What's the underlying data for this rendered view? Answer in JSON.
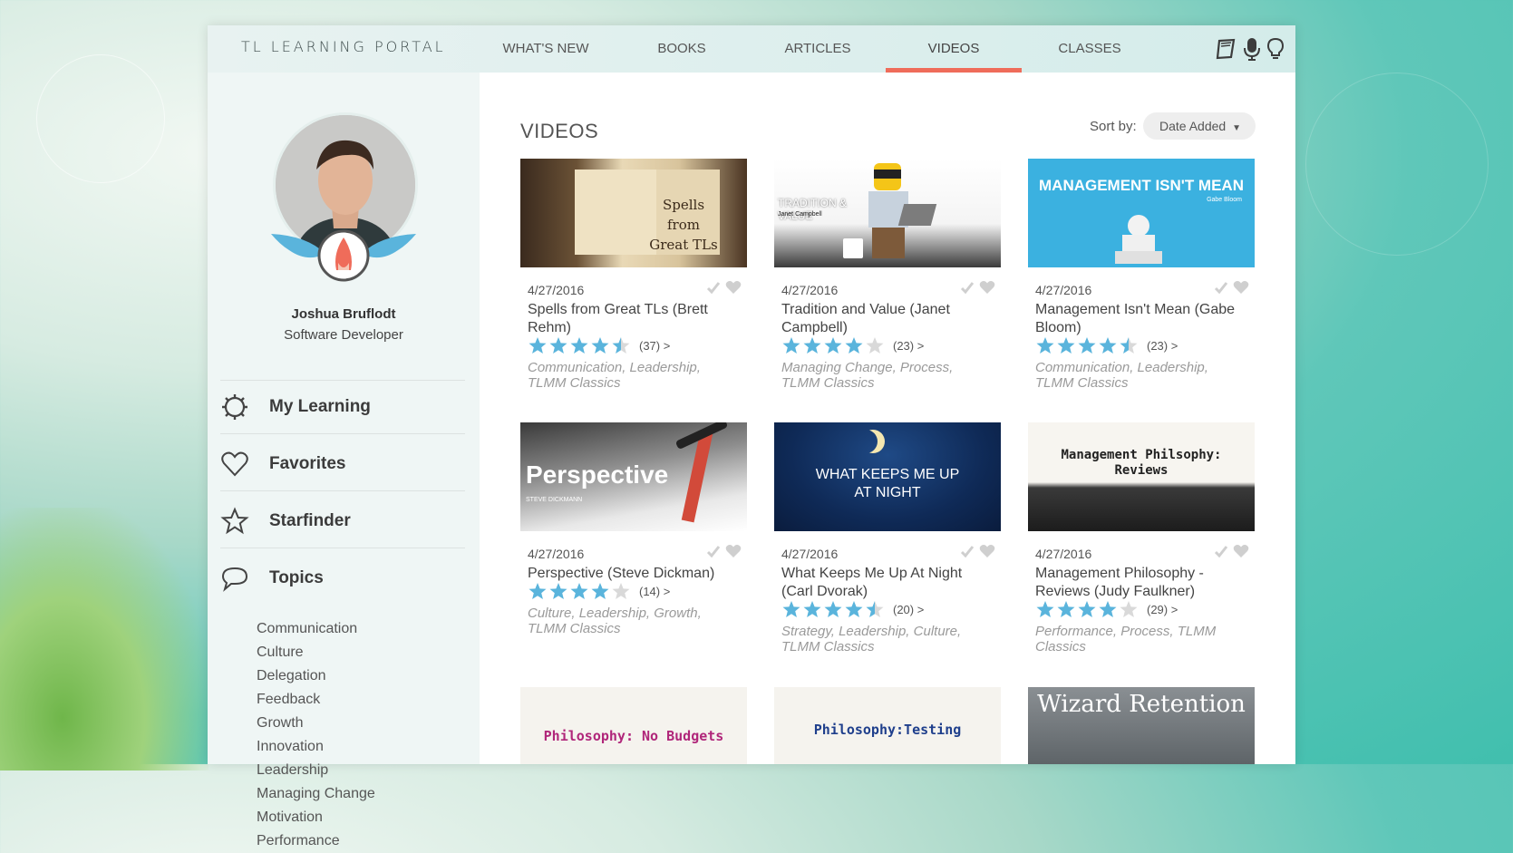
{
  "portal": {
    "title": "TL LEARNING PORTAL"
  },
  "nav": [
    {
      "label": "WHAT'S NEW",
      "active": false
    },
    {
      "label": "BOOKS",
      "active": false
    },
    {
      "label": "ARTICLES",
      "active": false
    },
    {
      "label": "VIDEOS",
      "active": true
    },
    {
      "label": "CLASSES",
      "active": false
    }
  ],
  "toolbar_icons": [
    "book-icon",
    "microphone-icon",
    "lightbulb-icon"
  ],
  "user": {
    "name": "Joshua Bruflodt",
    "title": "Software Developer"
  },
  "sidebar": {
    "links": [
      {
        "label": "My Learning",
        "icon": "gear-icon"
      },
      {
        "label": "Favorites",
        "icon": "heart-icon"
      },
      {
        "label": "Starfinder",
        "icon": "star-icon"
      },
      {
        "label": "Topics",
        "icon": "speech-bubble-icon"
      }
    ],
    "topics": [
      "Communication",
      "Culture",
      "Delegation",
      "Feedback",
      "Growth",
      "Innovation",
      "Leadership",
      "Managing Change",
      "Motivation",
      "Performance"
    ]
  },
  "main": {
    "heading": "VIDEOS",
    "sort_label": "Sort by:",
    "sort_value": "Date Added"
  },
  "videos": [
    {
      "date": "4/27/2016",
      "title": "Spells from Great TLs (Brett Rehm)",
      "rating": 4.5,
      "count": "(37) >",
      "tags": "Communication, Leadership, TLMM Classics",
      "thumb_text": "Spells from Great TLs"
    },
    {
      "date": "4/27/2016",
      "title": "Tradition and Value (Janet Campbell)",
      "rating": 4,
      "count": "(23) >",
      "tags": "Managing Change, Process, TLMM Classics",
      "thumb_text": "TRADITION & VALUE",
      "thumb_sub": "Janet Campbell"
    },
    {
      "date": "4/27/2016",
      "title": "Management Isn't Mean (Gabe Bloom)",
      "rating": 4.5,
      "count": "(23) >",
      "tags": "Communication, Leadership, TLMM Classics",
      "thumb_text": "MANAGEMENT ISN'T MEAN",
      "thumb_sub": "Gabe Bloom"
    },
    {
      "date": "4/27/2016",
      "title": "Perspective (Steve Dickman)",
      "rating": 4,
      "count": "(14) >",
      "tags": "Culture, Leadership, Growth, TLMM Classics",
      "thumb_text": "Perspective",
      "thumb_sub": "STEVE DICKMANN"
    },
    {
      "date": "4/27/2016",
      "title": "What Keeps Me Up At Night (Carl Dvorak)",
      "rating": 4.5,
      "count": "(20) >",
      "tags": "Strategy, Leadership, Culture, TLMM Classics",
      "thumb_text": "WHAT KEEPS ME UP AT NIGHT"
    },
    {
      "date": "4/27/2016",
      "title": "Management Philosophy - Reviews (Judy Faulkner)",
      "rating": 4,
      "count": "(29) >",
      "tags": "Performance, Process, TLMM Classics",
      "thumb_text": "Management Philsophy: Reviews"
    },
    {
      "thumb_text": "Philosophy: No Budgets"
    },
    {
      "thumb_text": "Philosophy:Testing"
    },
    {
      "thumb_text": "Wizard Retention"
    }
  ],
  "colors": {
    "accent": "#ef6c5a",
    "star": "#5ab4dc",
    "star_empty": "#d9d9d9"
  }
}
